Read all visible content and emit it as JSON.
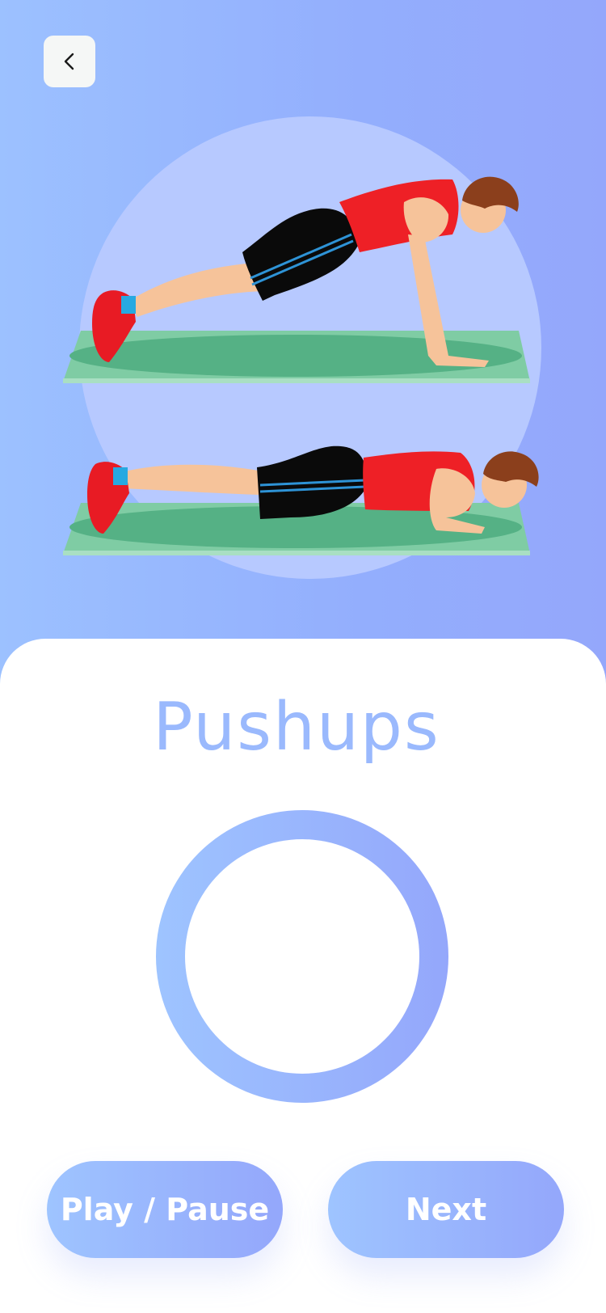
{
  "header": {
    "back_icon": "chevron-left-icon"
  },
  "exercise": {
    "title": "Pushups"
  },
  "timer": {
    "progress": 0
  },
  "controls": {
    "play_pause_label": "Play / Pause",
    "next_label": "Next"
  },
  "colors": {
    "accent": "#9ab9fd",
    "gradient_start": "#9ec4ff",
    "gradient_end": "#94a7fb"
  }
}
